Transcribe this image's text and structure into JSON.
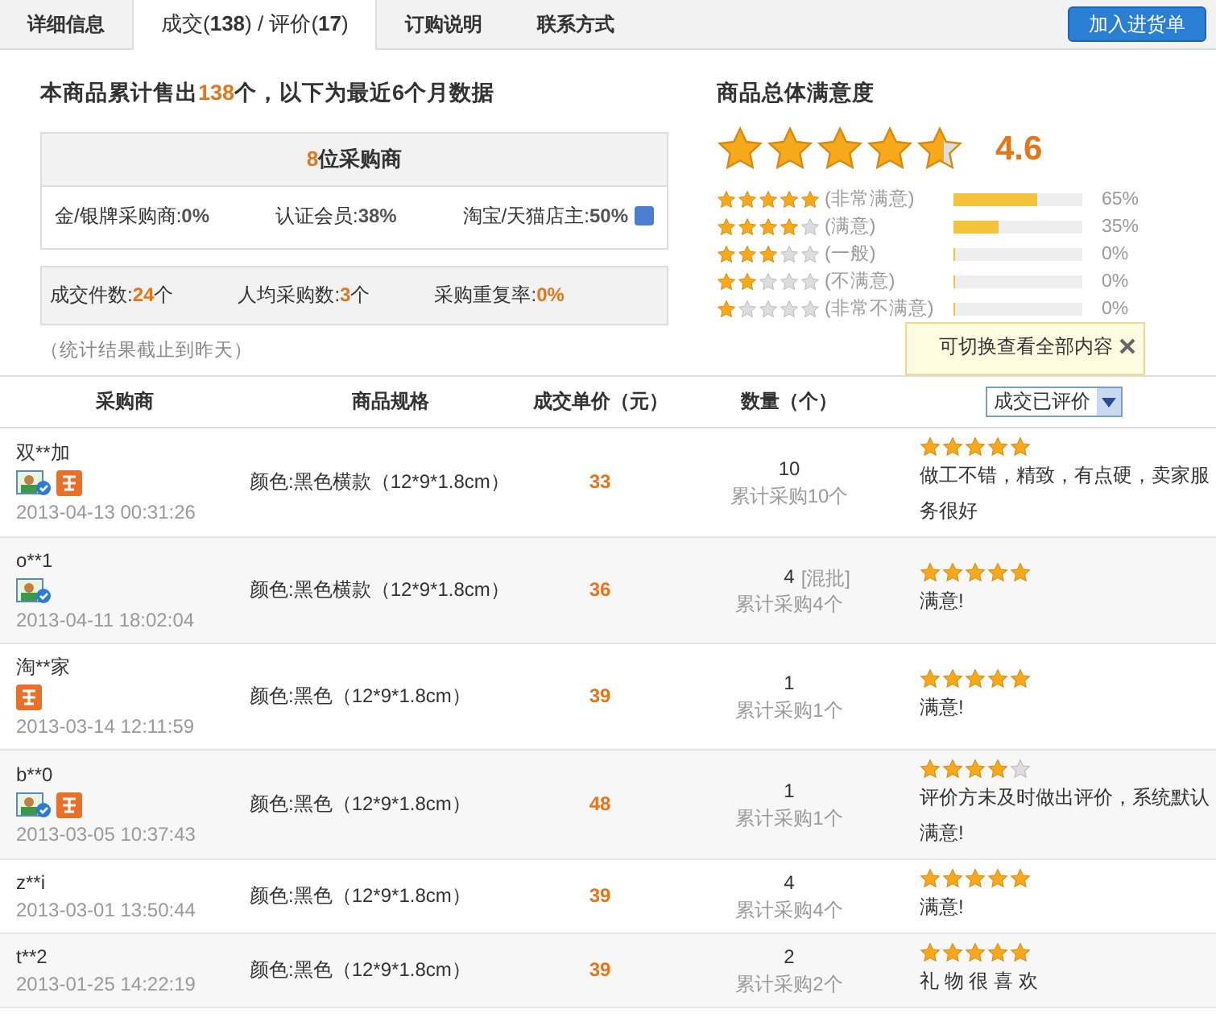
{
  "tabs": [
    {
      "label": "详细信息",
      "selected": false
    },
    {
      "label": "成交(**138**) / 评价(**17**)",
      "selected": true
    },
    {
      "label": "订购说明",
      "selected": false
    },
    {
      "label": "联系方式",
      "selected": false
    }
  ],
  "add_button": "加入进货单",
  "summary": {
    "heading": "本商品累计售出**138**个，以下为最近6个月数据",
    "buyers_title": "**8**位采购商",
    "buyer_stats": [
      {
        "label": "金/银牌采购商:",
        "value": "0%"
      },
      {
        "label": "认证会员:",
        "value": "38%"
      },
      {
        "label": "淘宝/天猫店主:",
        "value": "50%",
        "help": true
      }
    ],
    "trade_stats": [
      {
        "label": "成交件数:",
        "value": "24",
        "unit": "个"
      },
      {
        "label": "人均采购数:",
        "value": "3",
        "unit": "个"
      },
      {
        "label": "采购重复率:",
        "value": "0%"
      }
    ],
    "note": "（统计结果截止到昨天）"
  },
  "rating": {
    "title": "商品总体满意度",
    "stars": 4.6,
    "score": "4.6",
    "breakdown": [
      {
        "stars": 5,
        "label": "(非常满意)",
        "level": 0.65,
        "percent": "65%"
      },
      {
        "stars": 4,
        "label": "(满意)",
        "level": 0.35,
        "percent": "35%"
      },
      {
        "stars": 3,
        "label": "(一般)",
        "level": 0,
        "percent": "0%"
      },
      {
        "stars": 2,
        "label": "(不满意)",
        "level": 0,
        "percent": "0%"
      },
      {
        "stars": 1,
        "label": "(非常不满意)",
        "level": 0,
        "percent": "0%"
      }
    ]
  },
  "tooltip": "可切换查看全部内容",
  "filter": {
    "value": "成交已评价"
  },
  "table": {
    "columns": [
      "采购商",
      "商品规格",
      "成交单价（元）",
      "数量（个）"
    ],
    "rows": [
      {
        "buyer": "双**加",
        "verified": true,
        "shop_owner": true,
        "time": "2013-04-13 00:31:26",
        "spec": "颜色:黑色横款（12*9*1.8cm）",
        "price": "33",
        "qty": "10",
        "total": "累计采购10个",
        "stars": 5,
        "comment": "做工不错，精致，有点硬，卖家服务很好"
      },
      {
        "buyer": "o**1",
        "verified": true,
        "time": "2013-04-11 18:02:04",
        "spec": "颜色:黑色横款（12*9*1.8cm）",
        "price": "36",
        "qty": "4",
        "qty_note": "[混批]",
        "total": "累计采购4个",
        "stars": 5,
        "comment": "满意!"
      },
      {
        "buyer": "淘**家",
        "shop_owner": true,
        "time": "2013-03-14 12:11:59",
        "spec": "颜色:黑色（12*9*1.8cm）",
        "price": "39",
        "qty": "1",
        "total": "累计采购1个",
        "stars": 5,
        "comment": "满意!"
      },
      {
        "buyer": "b**0",
        "verified": true,
        "shop_owner": true,
        "time": "2013-03-05 10:37:43",
        "spec": "颜色:黑色（12*9*1.8cm）",
        "price": "48",
        "qty": "1",
        "total": "累计采购1个",
        "stars": 4,
        "comment": "评价方未及时做出评价，系统默认满意!"
      },
      {
        "buyer": "z**i",
        "time": "2013-03-01 13:50:44",
        "spec": "颜色:黑色（12*9*1.8cm）",
        "price": "39",
        "qty": "4",
        "total": "累计采购4个",
        "stars": 5,
        "comment": "满意!"
      },
      {
        "buyer": "t**2",
        "time": "2013-01-25 14:22:19",
        "spec": "颜色:黑色（12*9*1.8cm）",
        "price": "39",
        "qty": "2",
        "total": "累计采购2个",
        "stars": 5,
        "comment": "礼 物 很 喜 欢"
      }
    ]
  }
}
